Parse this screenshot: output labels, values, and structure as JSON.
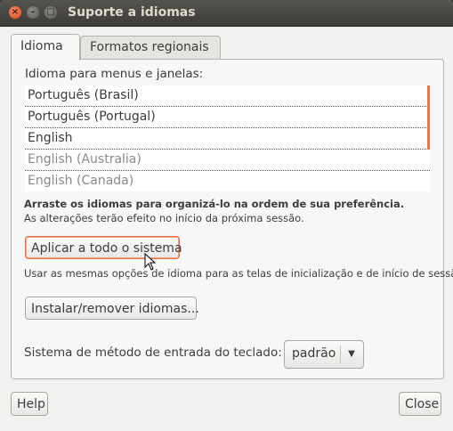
{
  "window": {
    "title": "Suporte a idiomas"
  },
  "tabs": [
    {
      "label": "Idioma"
    },
    {
      "label": "Formatos regionais"
    }
  ],
  "language_section": {
    "label": "Idioma para menus e janelas:",
    "items": [
      {
        "label": "Português (Brasil)"
      },
      {
        "label": "Português (Portugal)"
      },
      {
        "label": "English"
      },
      {
        "label": "English (Australia)"
      },
      {
        "label": "English (Canada)"
      }
    ],
    "hint_bold": "Arraste os idiomas para organizá-lo na ordem de sua preferência.",
    "hint": "As alterações terão efeito no início da próxima sessão."
  },
  "apply_button": {
    "label": "Aplicar a todo o sistema"
  },
  "apply_hint": "Usar as mesmas opções de idioma para as telas de inicialização e de início de sessão.",
  "install_button": {
    "label": "Instalar/remover idiomas..."
  },
  "input_method": {
    "label": "Sistema de método de entrada do teclado:",
    "value": "padrão"
  },
  "footer": {
    "help_label": "Help",
    "close_label": "Close"
  },
  "colors": {
    "accent": "#f07746",
    "titlebar": "#3c3b37",
    "close_button": "#df4b16"
  }
}
